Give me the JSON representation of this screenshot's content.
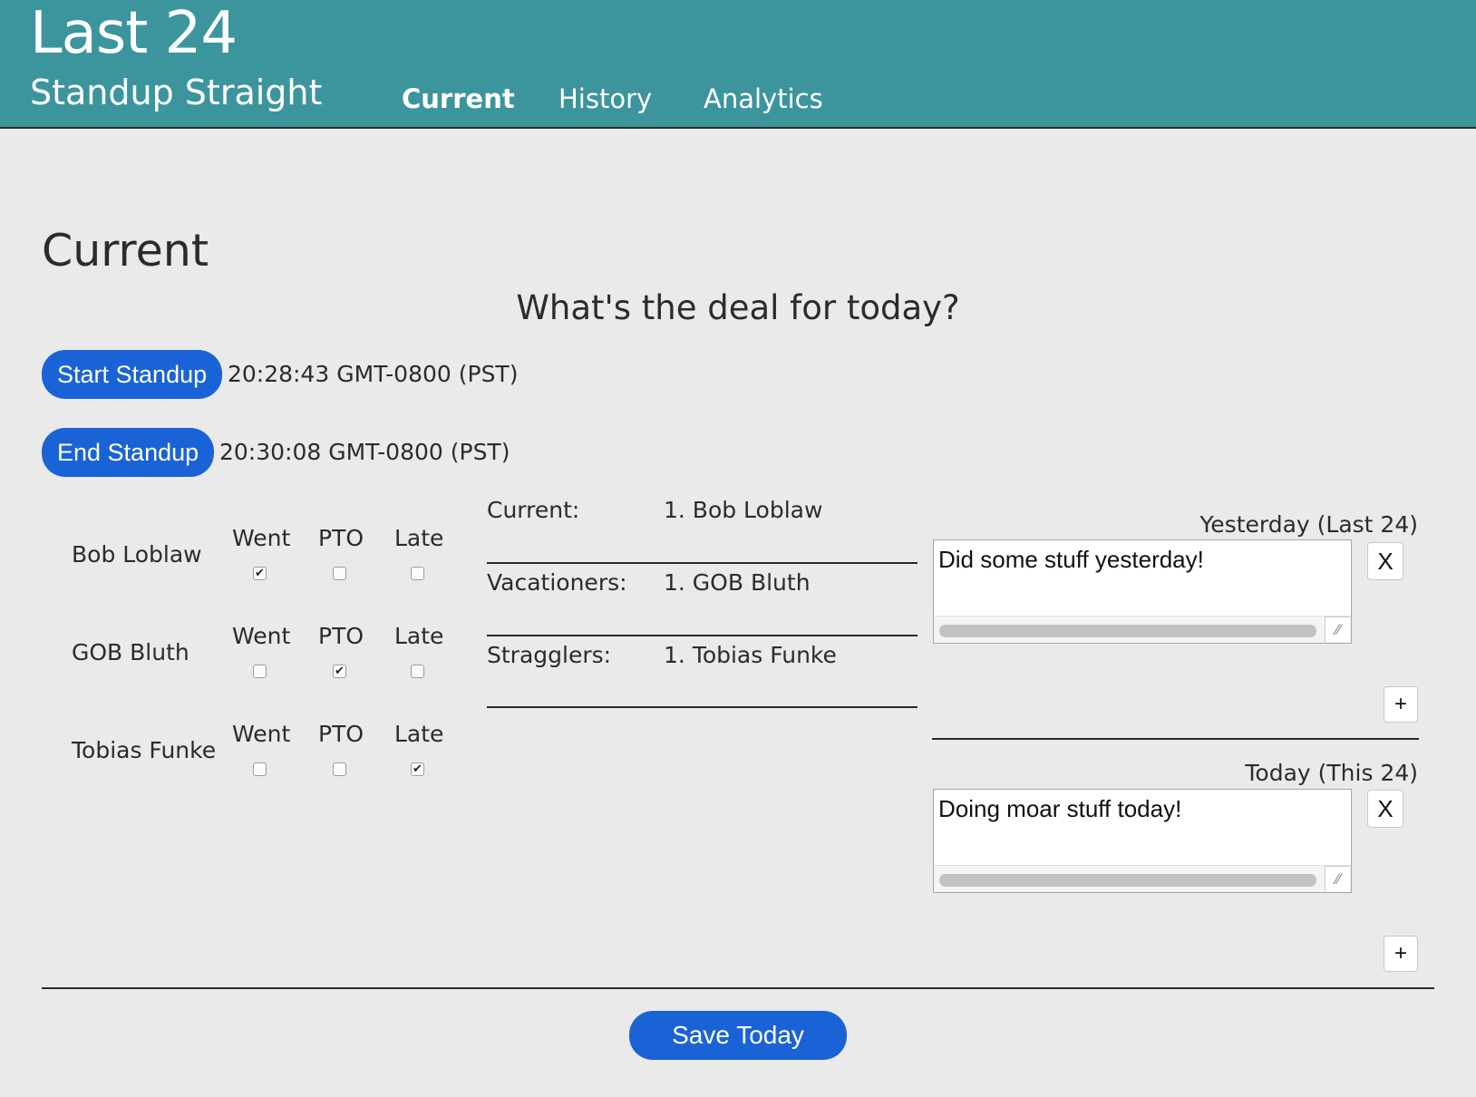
{
  "header": {
    "title": "Last 24",
    "subtitle": "Standup Straight",
    "nav": [
      {
        "label": "Current"
      },
      {
        "label": "History"
      },
      {
        "label": "Analytics"
      }
    ]
  },
  "page": {
    "title": "Current",
    "prompt": "What's the deal for today?"
  },
  "standup": {
    "start_label": "Start Standup",
    "start_time": "20:28:43 GMT-0800 (PST)",
    "end_label": "End Standup",
    "end_time": "20:30:08 GMT-0800 (PST)"
  },
  "attendance": {
    "columns": {
      "went": "Went",
      "pto": "PTO",
      "late": "Late"
    },
    "people": [
      {
        "name": "Bob Loblaw",
        "went": true,
        "pto": false,
        "late": false
      },
      {
        "name": "GOB Bluth",
        "went": false,
        "pto": true,
        "late": false
      },
      {
        "name": "Tobias Funke",
        "went": false,
        "pto": false,
        "late": true
      }
    ]
  },
  "summary": {
    "current_label": "Current:",
    "current_value": "1.  Bob Loblaw",
    "vacationers_label": "Vacationers:",
    "vacationers_value": "1.  GOB Bluth",
    "stragglers_label": "Stragglers:",
    "stragglers_value": "1.  Tobias Funke"
  },
  "notes": {
    "yesterday_label": "Yesterday (Last 24)",
    "yesterday_text": "Did some stuff yesterday!",
    "today_label": "Today (This 24)",
    "today_text": "Doing moar stuff today!",
    "remove_label": "X",
    "add_label": "+"
  },
  "footer": {
    "save_label": "Save Today"
  },
  "colors": {
    "header_bg": "#3c959d",
    "button_blue": "#1a63d6",
    "page_bg": "#eaeaea"
  }
}
